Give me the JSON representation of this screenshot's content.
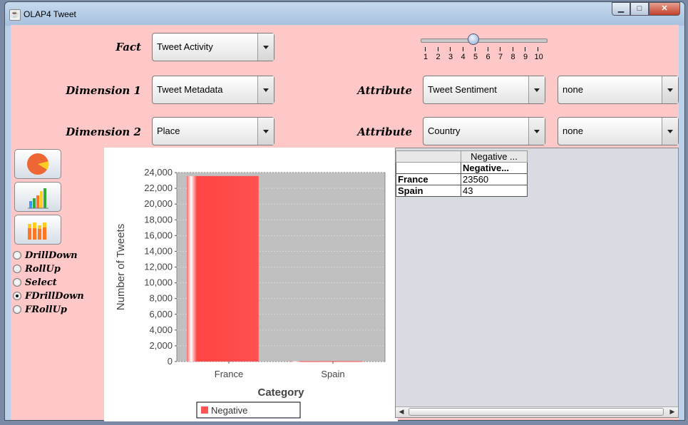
{
  "window": {
    "title": "OLAP4 Tweet"
  },
  "controls": {
    "fact_label": "Fact",
    "fact_value": "Tweet Activity",
    "dimension1_label": "Dimension 1",
    "dimension1_value": "Tweet Metadata",
    "dimension2_label": "Dimension 2",
    "dimension2_value": "Place",
    "attribute1_label": "Attribute",
    "attribute1_value": "Tweet Sentiment",
    "attribute1_extra": "none",
    "attribute2_label": "Attribute",
    "attribute2_value": "Country",
    "attribute2_extra": "none"
  },
  "slider": {
    "ticks": [
      "1",
      "2",
      "3",
      "4",
      "5",
      "6",
      "7",
      "8",
      "9",
      "10"
    ],
    "value": 5
  },
  "side_buttons": [
    {
      "icon": "pie-chart-icon"
    },
    {
      "icon": "bar-chart-icon"
    },
    {
      "icon": "stacked-bar-chart-icon"
    }
  ],
  "operations": [
    {
      "label": "DrillDown",
      "selected": false
    },
    {
      "label": "RollUp",
      "selected": false
    },
    {
      "label": "Select",
      "selected": false
    },
    {
      "label": "FDrillDown",
      "selected": true
    },
    {
      "label": "FRollUp",
      "selected": false
    }
  ],
  "chart_data": {
    "type": "bar",
    "categories": [
      "France",
      "Spain"
    ],
    "series": [
      {
        "name": "Negative",
        "values": [
          23560,
          43
        ],
        "color": "#ff5555"
      }
    ],
    "ylabel": "Number of Tweets",
    "xlabel": "Category",
    "ylim": [
      0,
      24000
    ],
    "yticks": [
      "0",
      "2,000",
      "4,000",
      "6,000",
      "8,000",
      "10,000",
      "12,000",
      "14,000",
      "16,000",
      "18,000",
      "20,000",
      "22,000",
      "24,000"
    ],
    "plot_background": "#c0c0c0",
    "grid": true,
    "legend": "bottom"
  },
  "table": {
    "header": [
      "",
      "Negative ..."
    ],
    "subheader": [
      "",
      "Negative..."
    ],
    "rows": [
      {
        "label": "France",
        "value": "23560"
      },
      {
        "label": "Spain",
        "value": "43"
      }
    ]
  }
}
